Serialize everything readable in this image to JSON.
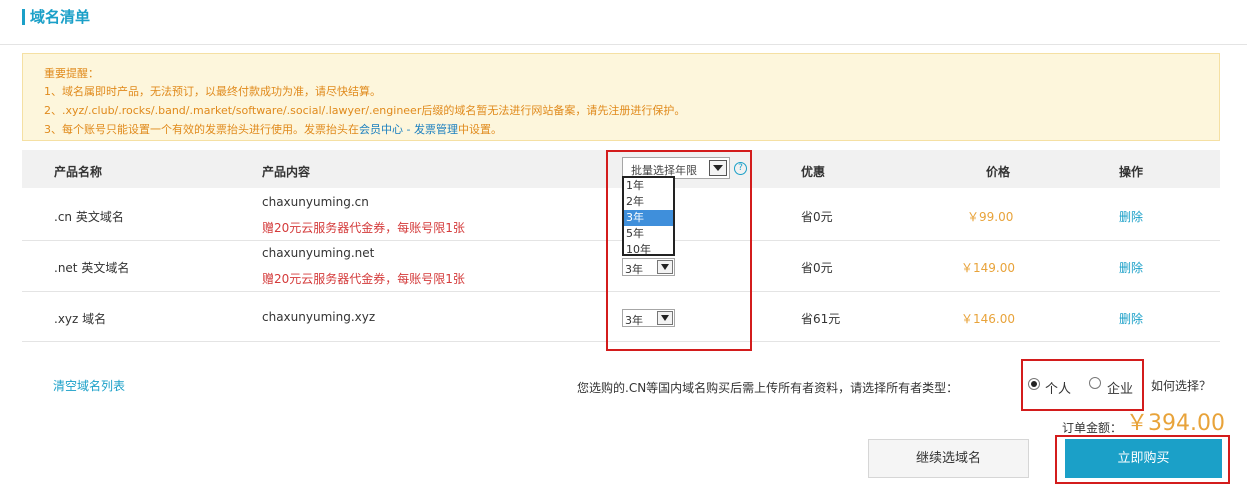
{
  "header": {
    "title": "域名清单"
  },
  "notice": {
    "heading": "重要提醒：",
    "line1": "1、域名属即时产品，无法预订，以最终付款成功为准，请尽快结算。",
    "line2": "2、.xyz/.club/.rocks/.band/.market/software/.social/.lawyer/.engineer后缀的域名暂无法进行网站备案，请先注册进行保护。",
    "line3_prefix": "3、每个账号只能设置一个有效的发票抬头进行使用。发票抬头在",
    "line3_link": "会员中心 - 发票管理",
    "line3_suffix": "中设置。"
  },
  "table": {
    "headers": {
      "name": "产品名称",
      "content": "产品内容",
      "discount": "优惠",
      "price": "价格",
      "action": "操作"
    },
    "batch_select_label": "批量选择年限",
    "help_icon": "question-icon",
    "rows": [
      {
        "name": ".cn 英文域名",
        "domain": "chaxunyuming.cn",
        "promo": "赠20元云服务器代金券，每账号限1张",
        "years": "3年",
        "discount": "省0元",
        "price": "￥99.00",
        "action": "删除"
      },
      {
        "name": ".net 英文域名",
        "domain": "chaxunyuming.net",
        "promo": "赠20元云服务器代金券，每账号限1张",
        "years": "3年",
        "discount": "省0元",
        "price": "￥149.00",
        "action": "删除"
      },
      {
        "name": ".xyz 域名",
        "domain": "chaxunyuming.xyz",
        "promo": "",
        "years": "3年",
        "discount": "省61元",
        "price": "￥146.00",
        "action": "删除"
      }
    ],
    "year_options": [
      "1年",
      "2年",
      "3年",
      "5年",
      "10年"
    ],
    "selected_option": "3年"
  },
  "footer": {
    "clear_list": "清空域名列表",
    "owner_prompt": "您选购的.CN等国内域名购买后需上传所有者资料，请选择所有者类型：",
    "owner_personal": "个人",
    "owner_company": "企业",
    "owner_selected": "个人",
    "how_to_choose": "如何选择？",
    "total_label": "订单金额：",
    "total_value": "￥394.00",
    "continue_button": "继续选域名",
    "buy_button": "立即购买"
  },
  "colors": {
    "accent": "#1ba0c8",
    "price": "#e8a33a",
    "warning": "#e08a1c",
    "highlight_box": "#d31c1c"
  }
}
